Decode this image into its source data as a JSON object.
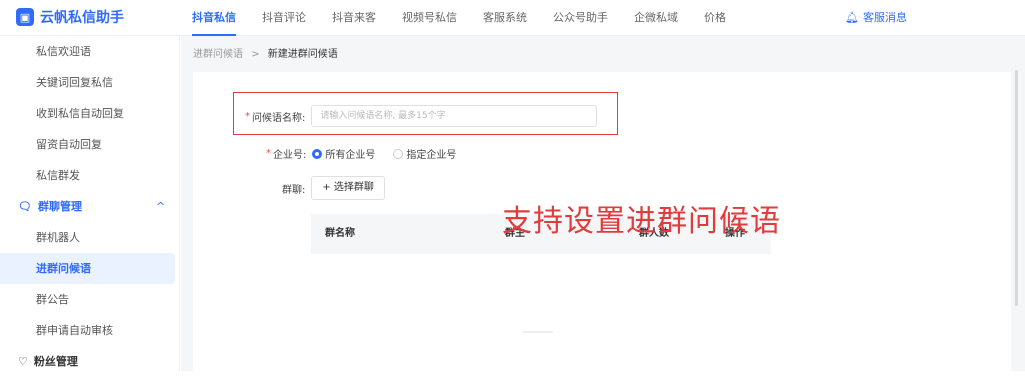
{
  "app": {
    "title": "云帆私信助手",
    "logo_glyph": "▣"
  },
  "nav": {
    "items": [
      "抖音私信",
      "抖音评论",
      "抖音来客",
      "视频号私信",
      "客服系统",
      "公众号助手",
      "企微私域",
      "价格"
    ],
    "active_index": 0
  },
  "header": {
    "message_label": "客服消息"
  },
  "sidebar": {
    "items_top": [
      "私信欢迎语",
      "关键词回复私信",
      "收到私信自动回复",
      "留资自动回复",
      "私信群发"
    ],
    "group_label": "群聊管理",
    "group_items": [
      "群机器人",
      "进群问候语",
      "群公告",
      "群申请自动审核"
    ],
    "group_active_index": 1,
    "next_group_label": "粉丝管理"
  },
  "breadcrumb": {
    "parent": "进群问候语",
    "separator": ">",
    "current": "新建进群问候语"
  },
  "form": {
    "greeting_name_label": "问候语名称:",
    "greeting_name_placeholder": "请输入问候语名称, 最多15个字",
    "enterprise_label": "企业号:",
    "enterprise_options": [
      "所有企业号",
      "指定企业号"
    ],
    "enterprise_selected": 0,
    "group_label": "群聊:",
    "select_group_button": "+ 选择群聊"
  },
  "table": {
    "columns": [
      "群名称",
      "群主",
      "群人数",
      "操作"
    ]
  },
  "overlay_caption": "支持设置进群问候语",
  "colors": {
    "accent": "#2f6bff",
    "annotation": "#e23b3b"
  }
}
